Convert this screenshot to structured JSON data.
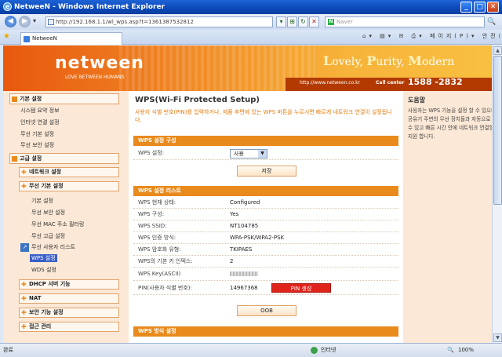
{
  "window": {
    "title": "NetweeN - Windows Internet Explorer",
    "min_glyph": "_",
    "max_glyph": "□",
    "close_glyph": "✕"
  },
  "browser": {
    "back_glyph": "◀",
    "forward_glyph": "▶",
    "dropdown_glyph": "▾",
    "address": "http://192.168.1.1/wl_wps.asp?t=1361387532812",
    "compat_glyph": "⊞",
    "refresh_glyph": "↻",
    "stop_glyph": "✕",
    "search_placeholder": "Naver",
    "search_brand_glyph": "N",
    "search_go_glyph": "🔍",
    "favorites_glyph": "★",
    "tab_title": "NetweeN",
    "tools": "⌂▾ ▤▾ ✉ ⎙▾ 페이지(P)▾ 안전(S)▾ 도구(O)▾ ?▾"
  },
  "banner": {
    "logo": "netween",
    "logo_sub": "LOVE BETWEEN HUMANS",
    "slogan_1": "L",
    "slogan_1r": "ovely, ",
    "slogan_2": "P",
    "slogan_2r": "urity, ",
    "slogan_3": "M",
    "slogan_3r": "odern",
    "site_url": "http://www.netween.co.kr",
    "call_label": "Call center",
    "call_number": "1588 -2832"
  },
  "sidebar": {
    "basic_group": "기본 설정",
    "basic_items": [
      "시스템 요약 정보",
      "인터넷 연결 설정",
      "무선 기본 설정",
      "무선 보안 설정"
    ],
    "advanced_group": "고급 설정",
    "network_settings": "네트워크 설정",
    "wireless_basic": "무선 기본 설정",
    "wireless_items": [
      "기본 설정",
      "무선 보안 설정",
      "무선 MAC 주소 필터링",
      "무선 고급 설정",
      "무선 사용자 리스트",
      "WPS 설정",
      "WDS 설정"
    ],
    "dhcp": "DHCP 서버 기능",
    "nat": "NAT",
    "security": "보안 기능 설정",
    "access": "접근 관리"
  },
  "main": {
    "title": "WPS(Wi-Fi Protected Setup)",
    "description": "사용자 식별 번호(PIN)를 입력하거나, 제품 후면에 있는 WPS 버튼을 누르시면 빠르게 네트워크 연결이 설정됩니다.",
    "config_header": "WPS 설정 구성",
    "wps_setting_label": "WPS 설정:",
    "wps_setting_value": "사용",
    "save_button": "저장",
    "list_header": "WPS 설정 리스트",
    "rows": [
      {
        "k": "WPS 현재 상태:",
        "v": "Configured"
      },
      {
        "k": "WPS 구성:",
        "v": "Yes"
      },
      {
        "k": "WPS SSID:",
        "v": "NT104785"
      },
      {
        "k": "WPS 인증 방식:",
        "v": "WPA-PSK/WPA2-PSK"
      },
      {
        "k": "WPS 암호화 유형:",
        "v": "TKIPAES"
      },
      {
        "k": "WPS의 기본 키 인덱스:",
        "v": "2"
      }
    ],
    "key_label": "WPS Key(ASCII)",
    "pin_label": "PIN(사용자 식별 번호):",
    "pin_value": "14967368",
    "pin_button": "PIN 생성",
    "oob_button": "OOB",
    "method_header": "WPS 방식 설정"
  },
  "help": {
    "title": "도움말",
    "text": "사용자는 WPS 기능을 설정 할 수 있으며 유무선 공유기 주변의 무선 장치들과 자동으로 동기화 할 수 있고 빠른 시간 안에 네트워크 연결할 수 있도록 지원 합니다."
  },
  "status": {
    "left": "완료",
    "zone": "인터넷",
    "zoom": "100%"
  },
  "colors": {
    "accent": "#e98a1c",
    "panel": "#fbe8d6",
    "pin_button": "#e0231b"
  }
}
